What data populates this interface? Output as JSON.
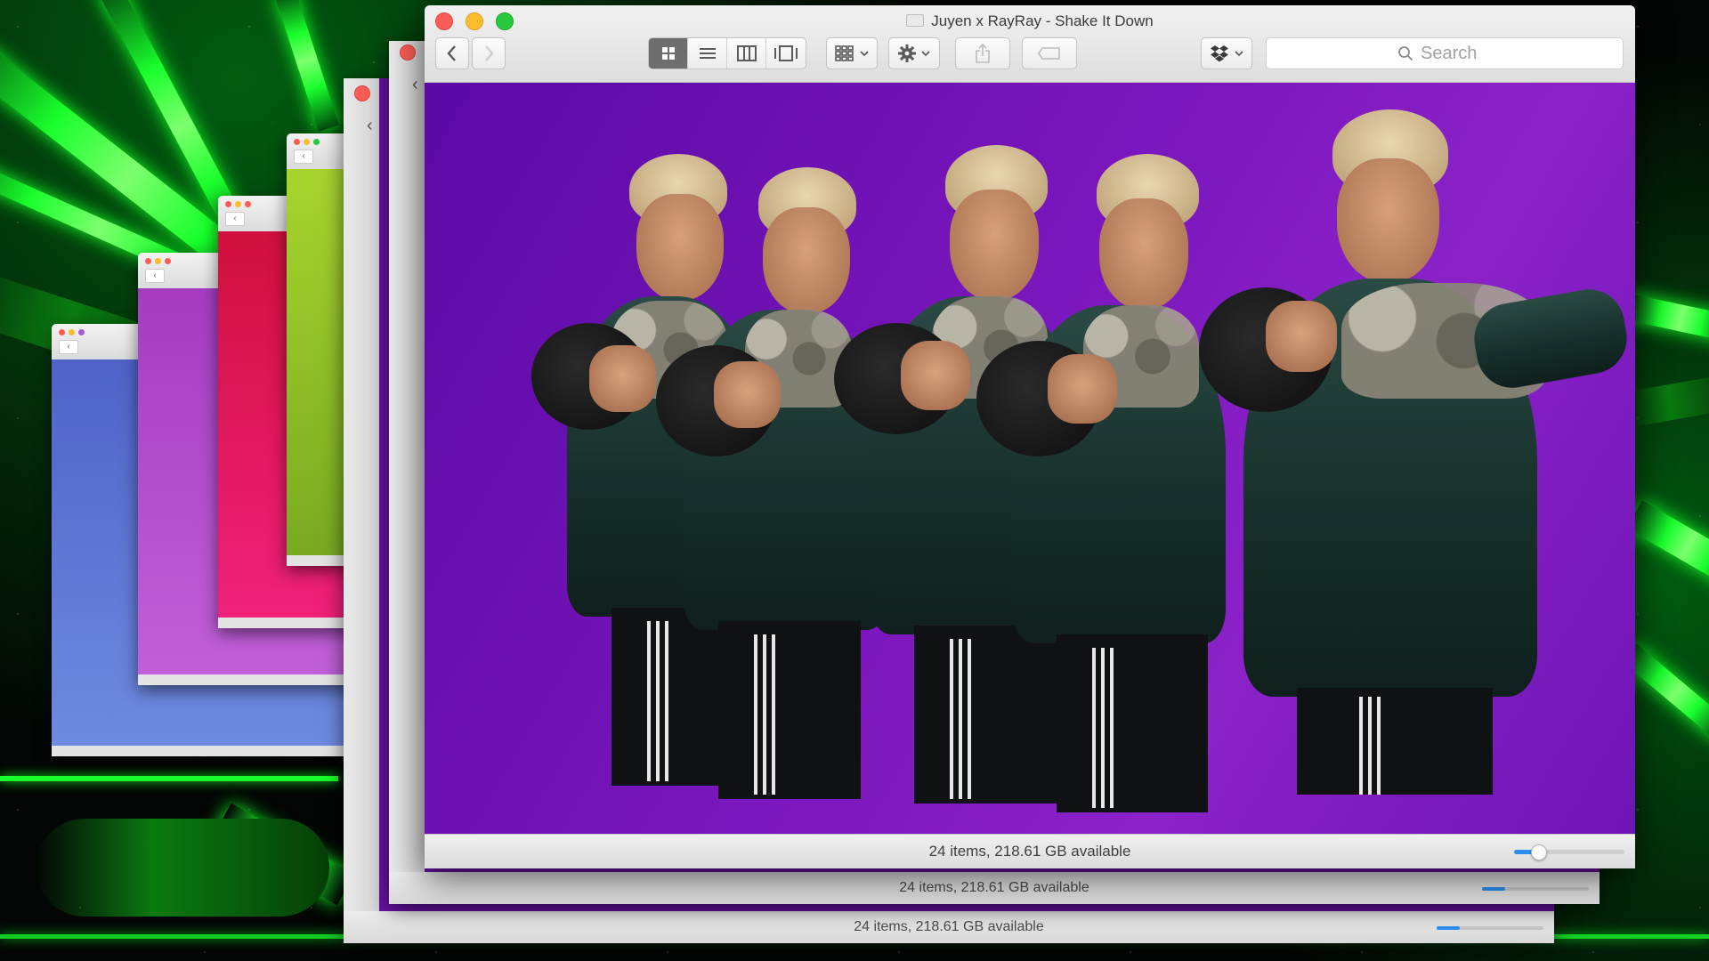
{
  "window": {
    "title": "Juyen x RayRay - Shake It Down",
    "status": "24 items, 218.61 GB available",
    "zoom_level": 0.22
  },
  "toolbar": {
    "back_icon": "chevron-left-icon",
    "forward_icon": "chevron-right-icon",
    "view_modes": [
      "icon-view-icon",
      "list-view-icon",
      "column-view-icon",
      "cover-flow-icon"
    ],
    "active_view": "icon-view-icon",
    "arrange_icon": "arrange-grid-icon",
    "action_icon": "gear-icon",
    "share_icon": "share-icon",
    "tags_icon": "tag-icon",
    "dropbox_icon": "dropbox-icon"
  },
  "search": {
    "placeholder": "Search",
    "value": ""
  },
  "stacked_windows": [
    {
      "status": "24 items, 218.61 GB available"
    },
    {
      "status": "24 items, 218.61 GB available"
    }
  ],
  "colors": {
    "accent": "#2b8ef0",
    "close": "#fc5d57",
    "minimize": "#fdbc2e",
    "maximize": "#28c840",
    "content_bg": "#7a16bd",
    "background_glow": "#19ff2c",
    "back_windows": [
      "#5a6fd0",
      "#b04cc8",
      "#e0185c",
      "#98c828"
    ]
  }
}
